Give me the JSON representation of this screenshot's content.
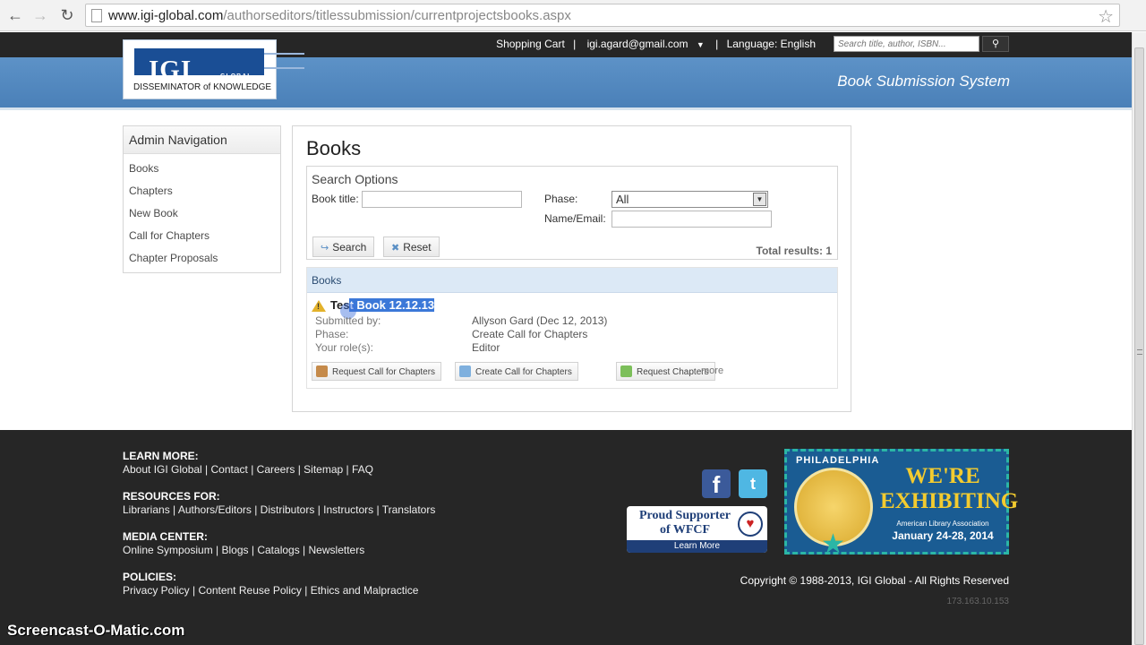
{
  "browser": {
    "url_host": "www.igi-global.com",
    "url_path": "/authorseditors/titlessubmission/currentprojectsbooks.aspx"
  },
  "topbar": {
    "shopping_cart": "Shopping Cart",
    "user_email": "igi.agard@gmail.com",
    "language": "Language: English",
    "search_placeholder": "Search title, author, ISBN..."
  },
  "logo": {
    "brand": "IGI",
    "brand_suffix": "GLOBAL",
    "tagline": "DISSEMINATOR of KNOWLEDGE"
  },
  "banner": {
    "title": "Book Submission System"
  },
  "sidebar": {
    "title": "Admin Navigation",
    "items": [
      {
        "label": "Books"
      },
      {
        "label": "Chapters"
      },
      {
        "label": "New Book"
      },
      {
        "label": "Call for Chapters"
      },
      {
        "label": "Chapter Proposals"
      }
    ]
  },
  "main": {
    "title": "Books",
    "search": {
      "title": "Search Options",
      "book_title_label": "Book title:",
      "book_title_value": "",
      "phase_label": "Phase:",
      "phase_value": "All",
      "name_email_label": "Name/Email:",
      "name_email_value": "",
      "search_button": "Search",
      "reset_button": "Reset",
      "total_results": "Total results: 1"
    },
    "results": {
      "header": "Books",
      "book": {
        "title_prefix": "Tes",
        "title_selected": "t Book 12.12.13",
        "submitted_by_label": "Submitted by:",
        "submitted_by_value": "Allyson Gard (Dec 12, 2013)",
        "phase_label": "Phase:",
        "phase_value": "Create Call for Chapters",
        "role_label": "Your role(s):",
        "role_value": "Editor"
      },
      "actions": [
        {
          "label": "Request Call for Chapters"
        },
        {
          "label": "Create Call for Chapters"
        },
        {
          "label": "Request Chapters"
        }
      ],
      "more": "more"
    }
  },
  "footer": {
    "sections": [
      {
        "heading": "LEARN MORE:",
        "links": [
          "About IGI Global",
          "Contact",
          "Careers",
          "Sitemap",
          "FAQ"
        ]
      },
      {
        "heading": "RESOURCES FOR:",
        "links": [
          "Librarians",
          "Authors/Editors",
          "Distributors",
          "Instructors",
          "Translators"
        ]
      },
      {
        "heading": "MEDIA CENTER:",
        "links": [
          "Online Symposium",
          "Blogs",
          "Catalogs",
          "Newsletters"
        ]
      },
      {
        "heading": "POLICIES:",
        "links": [
          "Privacy Policy",
          "Content Reuse Policy",
          "Ethics and Malpractice"
        ]
      }
    ],
    "wfcf": {
      "line1": "Proud Supporter",
      "line2": "of WFCF",
      "learn_more": "Learn More"
    },
    "exhibit": {
      "city": "PHILADELPHIA",
      "headline_1": "WE'RE",
      "headline_2": "EXHIBITING",
      "association": "American Library Association",
      "dates": "January 24-28, 2014"
    },
    "copyright": "Copyright © 1988-2013, IGI Global - All Rights Reserved",
    "ip": "173.163.10.153"
  },
  "watermark": "Screencast-O-Matic.com",
  "icons": {
    "back": "back-arrow-icon",
    "forward": "forward-arrow-icon",
    "reload": "reload-icon",
    "bookmark": "star-icon",
    "warning": "warning-icon"
  }
}
